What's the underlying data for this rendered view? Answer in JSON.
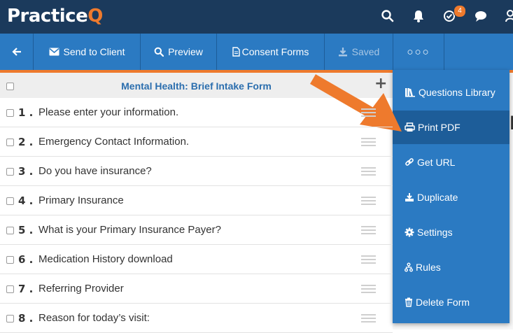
{
  "app": {
    "logo_main": "Practice",
    "logo_accent": "Q",
    "notification_count": "4"
  },
  "toolbar": {
    "send_to_client": "Send to Client",
    "preview": "Preview",
    "consent_forms": "Consent Forms",
    "saved": "Saved",
    "more": "○○○"
  },
  "form": {
    "title": "Mental Health: Brief Intake Form",
    "add_symbol": "+",
    "questions": [
      {
        "number": "1 .",
        "text": "Please enter your information."
      },
      {
        "number": "2 .",
        "text": "Emergency Contact Information."
      },
      {
        "number": "3 .",
        "text": "Do you have insurance?"
      },
      {
        "number": "4 .",
        "text": "Primary Insurance"
      },
      {
        "number": "5 .",
        "text": "What is your Primary Insurance Payer?"
      },
      {
        "number": "6 .",
        "text": "Medication History download"
      },
      {
        "number": "7 .",
        "text": "Referring Provider"
      },
      {
        "number": "8 .",
        "text": "Reason for today’s visit:"
      }
    ]
  },
  "menu": {
    "items": [
      {
        "label": "Questions Library",
        "icon": "books-icon"
      },
      {
        "label": "Print PDF",
        "icon": "printer-icon"
      },
      {
        "label": "Get URL",
        "icon": "link-icon"
      },
      {
        "label": "Duplicate",
        "icon": "duplicate-icon"
      },
      {
        "label": "Settings",
        "icon": "gear-icon"
      },
      {
        "label": "Rules",
        "icon": "rules-icon"
      },
      {
        "label": "Delete Form",
        "icon": "trash-icon"
      }
    ]
  },
  "colors": {
    "topbar": "#1b3a5c",
    "toolbar": "#2b7ac2",
    "accent": "#ee7a2d",
    "menu_active": "#1d5d99"
  }
}
